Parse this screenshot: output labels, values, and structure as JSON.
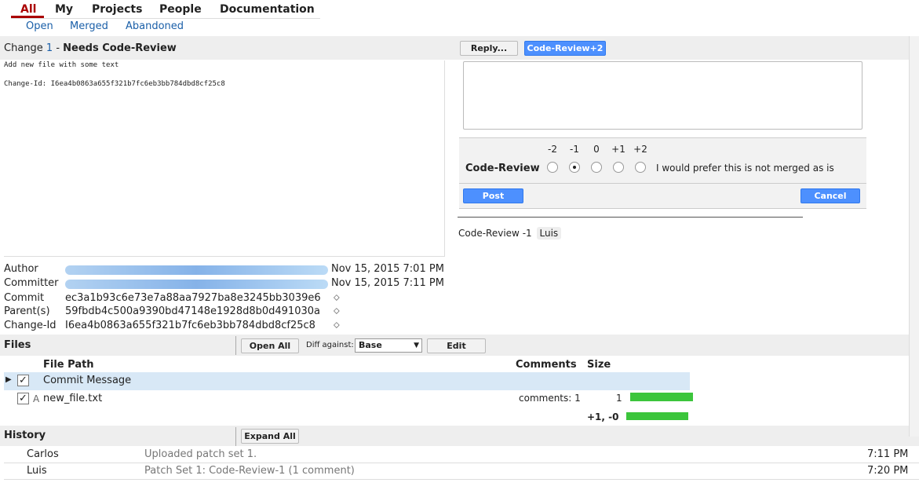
{
  "nav": {
    "tabs": [
      "All",
      "My",
      "Projects",
      "People",
      "Documentation"
    ],
    "subtabs": [
      "Open",
      "Merged",
      "Abandoned"
    ]
  },
  "change": {
    "prefix": "Change ",
    "number": "1",
    "separator": " - ",
    "status": "Needs Code-Review",
    "commit_message_line1": "Add new file with some text",
    "commit_message_line2": "Change-Id: I6ea4b0863a655f321b7fc6eb3bb784dbd8cf25c8"
  },
  "actions": {
    "reply_label": "Reply...",
    "vote_label": "Code-Review+2"
  },
  "review": {
    "scores": [
      "-2",
      "-1",
      "0",
      "+1",
      "+2"
    ],
    "selected_index": 1,
    "label": "Code-Review",
    "description": "I would prefer this is not merged as is",
    "post_label": "Post",
    "cancel_label": "Cancel",
    "summary_label": "Code-Review",
    "summary_score": "-1",
    "summary_user": "Luis"
  },
  "meta": {
    "author_label": "Author",
    "author_date": "Nov 15, 2015 7:01 PM",
    "committer_label": "Committer",
    "committer_date": "Nov 15, 2015 7:11 PM",
    "commit_label": "Commit",
    "commit_value": "ec3a1b93c6e73e7a88aa7927ba8e3245bb3039e6",
    "parent_label": "Parent(s)",
    "parent_value": "59fbdb4c500a9390bd47148e1928d8b0d491030a",
    "changeid_label": "Change-Id",
    "changeid_value": "I6ea4b0863a655f321b7fc6eb3bb784dbd8cf25c8",
    "copy_glyph": "⬦"
  },
  "files": {
    "title": "Files",
    "open_all_label": "Open All",
    "diff_against_label": "Diff against:",
    "diff_against_value": "Base",
    "edit_label": "Edit",
    "col_path": "File Path",
    "col_comments": "Comments",
    "col_size": "Size",
    "rows": [
      {
        "status": "",
        "path": "Commit Message",
        "comments": "",
        "size": ""
      },
      {
        "status": "A",
        "path": "new_file.txt",
        "comments": "comments: 1",
        "size": "1"
      }
    ],
    "total": "+1, -0"
  },
  "history": {
    "title": "History",
    "expand_all_label": "Expand All",
    "rows": [
      {
        "name": "Carlos",
        "message": "Uploaded patch set 1.",
        "time": "7:11 PM"
      },
      {
        "name": "Luis",
        "message": "Patch Set 1: Code-Review-1 (1 comment)",
        "time": "7:20 PM"
      }
    ]
  },
  "colors": {
    "accent": "#aa0000",
    "link": "#1a5fa8",
    "primary_button": "#4d90fe",
    "size_bar": "#3cc53c",
    "selected_row": "#d8e8f6"
  }
}
